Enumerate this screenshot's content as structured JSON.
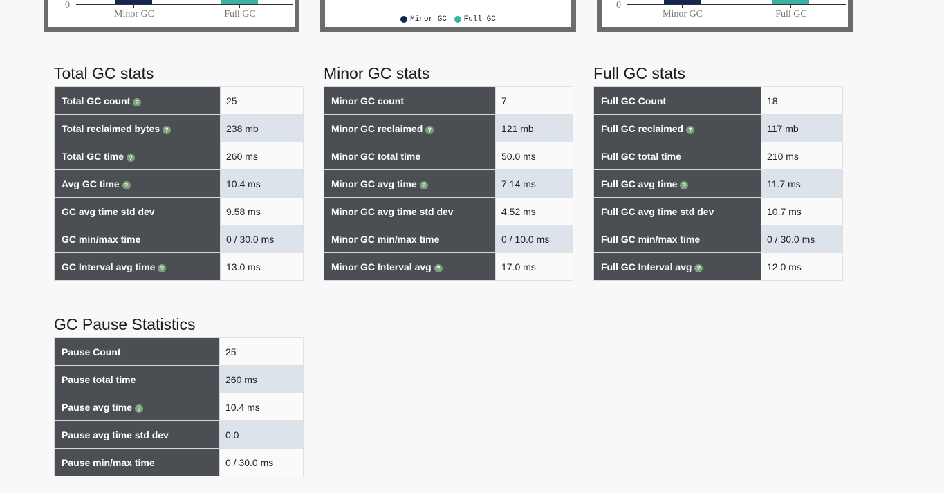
{
  "charts": [
    {
      "chart_data": {
        "type": "bar",
        "categories": [
          "Minor GC",
          "Full GC"
        ],
        "colors": [
          "#15254f",
          "#3bb1a3"
        ],
        "y_tick_visible": "0"
      }
    },
    {
      "legend": [
        {
          "label": "Minor GC",
          "color": "#15254f"
        },
        {
          "label": "Full GC",
          "color": "#3bb1a3"
        }
      ]
    },
    {
      "chart_data": {
        "type": "bar",
        "categories": [
          "Minor GC",
          "Full GC"
        ],
        "colors": [
          "#15254f",
          "#3bb1a3"
        ],
        "y_tick_visible": "0"
      }
    }
  ],
  "total": {
    "title": "Total GC stats",
    "rows": [
      {
        "label": "Total GC count",
        "value": "25",
        "help": true
      },
      {
        "label": "Total reclaimed bytes",
        "value": "238 mb",
        "help": true
      },
      {
        "label": "Total GC time",
        "value": "260 ms",
        "help": true
      },
      {
        "label": "Avg GC time",
        "value": "10.4 ms",
        "help": true
      },
      {
        "label": "GC avg time std dev",
        "value": "9.58 ms",
        "help": false
      },
      {
        "label": "GC min/max time",
        "value": "0 / 30.0 ms",
        "help": false
      },
      {
        "label": "GC Interval avg time",
        "value": "13.0 ms",
        "help": true
      }
    ]
  },
  "minor": {
    "title": "Minor GC stats",
    "rows": [
      {
        "label": "Minor GC count",
        "value": "7",
        "help": false
      },
      {
        "label": "Minor GC reclaimed",
        "value": "121 mb",
        "help": true
      },
      {
        "label": "Minor GC total time",
        "value": "50.0 ms",
        "help": false
      },
      {
        "label": "Minor GC avg time",
        "value": "7.14 ms",
        "help": true
      },
      {
        "label": "Minor GC avg time std dev",
        "value": "4.52 ms",
        "help": false
      },
      {
        "label": "Minor GC min/max time",
        "value": "0 / 10.0 ms",
        "help": false
      },
      {
        "label": "Minor GC Interval avg",
        "value": "17.0 ms",
        "help": true
      }
    ]
  },
  "full": {
    "title": "Full GC stats",
    "rows": [
      {
        "label": "Full GC Count",
        "value": "18",
        "help": false
      },
      {
        "label": "Full GC reclaimed",
        "value": "117 mb",
        "help": true
      },
      {
        "label": "Full GC total time",
        "value": "210 ms",
        "help": false
      },
      {
        "label": "Full GC avg time",
        "value": "11.7 ms",
        "help": true
      },
      {
        "label": "Full GC avg time std dev",
        "value": "10.7 ms",
        "help": false
      },
      {
        "label": "Full GC min/max time",
        "value": "0 / 30.0 ms",
        "help": false
      },
      {
        "label": "Full GC Interval avg",
        "value": "12.0 ms",
        "help": true
      }
    ]
  },
  "pause": {
    "title": "GC Pause Statistics",
    "rows": [
      {
        "label": "Pause Count",
        "value": "25",
        "help": false
      },
      {
        "label": "Pause total time",
        "value": "260 ms",
        "help": false
      },
      {
        "label": "Pause avg time",
        "value": "10.4 ms",
        "help": true
      },
      {
        "label": "Pause avg time std dev",
        "value": "0.0",
        "help": false
      },
      {
        "label": "Pause min/max time",
        "value": "0 / 30.0 ms",
        "help": false
      }
    ]
  },
  "help_icon_glyph": "?"
}
